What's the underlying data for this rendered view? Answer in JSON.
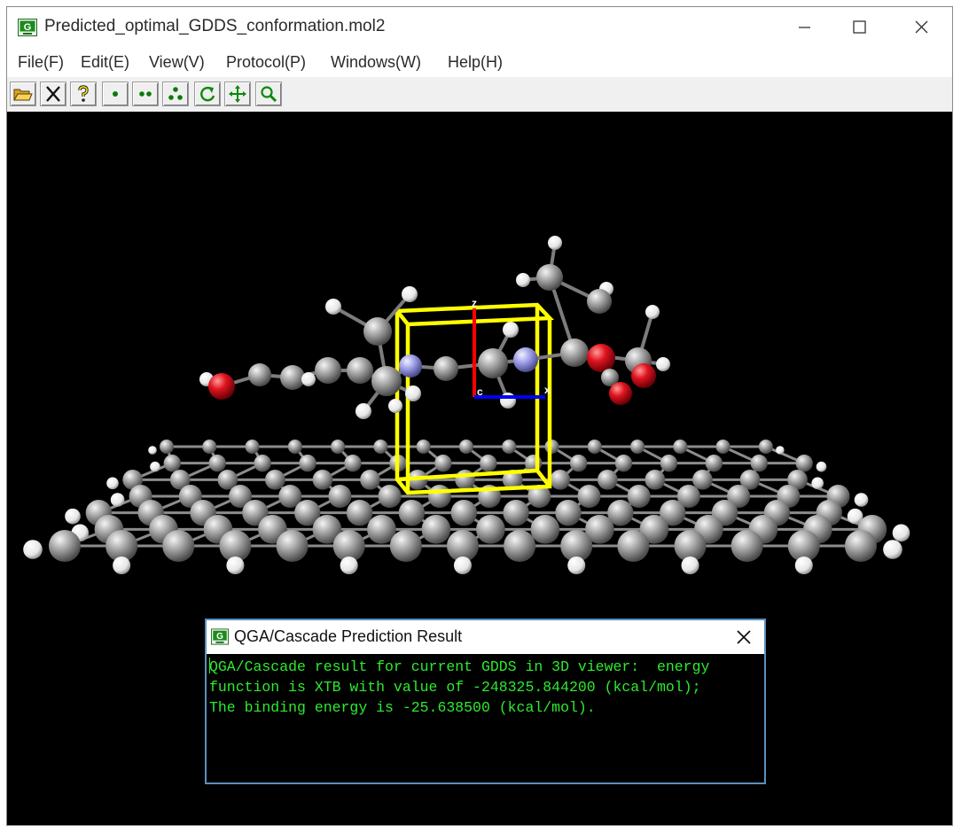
{
  "window": {
    "title": "Predicted_optimal_GDDS_conformation.mol2"
  },
  "menu": [
    {
      "label": "File(F)"
    },
    {
      "label": "Edit(E)"
    },
    {
      "label": "View(V)"
    },
    {
      "label": "Protocol(P)"
    },
    {
      "label": "Windows(W)"
    },
    {
      "label": "Help(H)"
    }
  ],
  "toolbar": [
    {
      "icon": "open-folder-icon"
    },
    {
      "icon": "close-x-icon"
    },
    {
      "icon": "help-question-icon"
    },
    {
      "icon": "one-dot-icon"
    },
    {
      "icon": "two-dots-icon"
    },
    {
      "icon": "three-dots-icon"
    },
    {
      "icon": "rotate-icon"
    },
    {
      "icon": "move-icon"
    },
    {
      "icon": "zoom-icon"
    }
  ],
  "viewer": {
    "axis_labels": {
      "z": "z",
      "x": "x",
      "c": "c"
    },
    "colors": {
      "background": "#000000",
      "carbon": "#9e9e9e",
      "hydrogen": "#ffffff",
      "nitrogen": "#9a9ae6",
      "oxygen": "#e0141e",
      "box": "#ffff00",
      "axis_z": "#ff0000",
      "axis_x": "#0000ff"
    }
  },
  "dialog": {
    "title": "QGA/Cascade Prediction Result",
    "lines": [
      "QGA/Cascade result for current GDDS in 3D viewer:  energy",
      "function is XTB with value of -248325.844200 (kcal/mol);",
      "The binding energy is -25.638500 (kcal/mol)."
    ],
    "text_color": "#2eea2e"
  }
}
